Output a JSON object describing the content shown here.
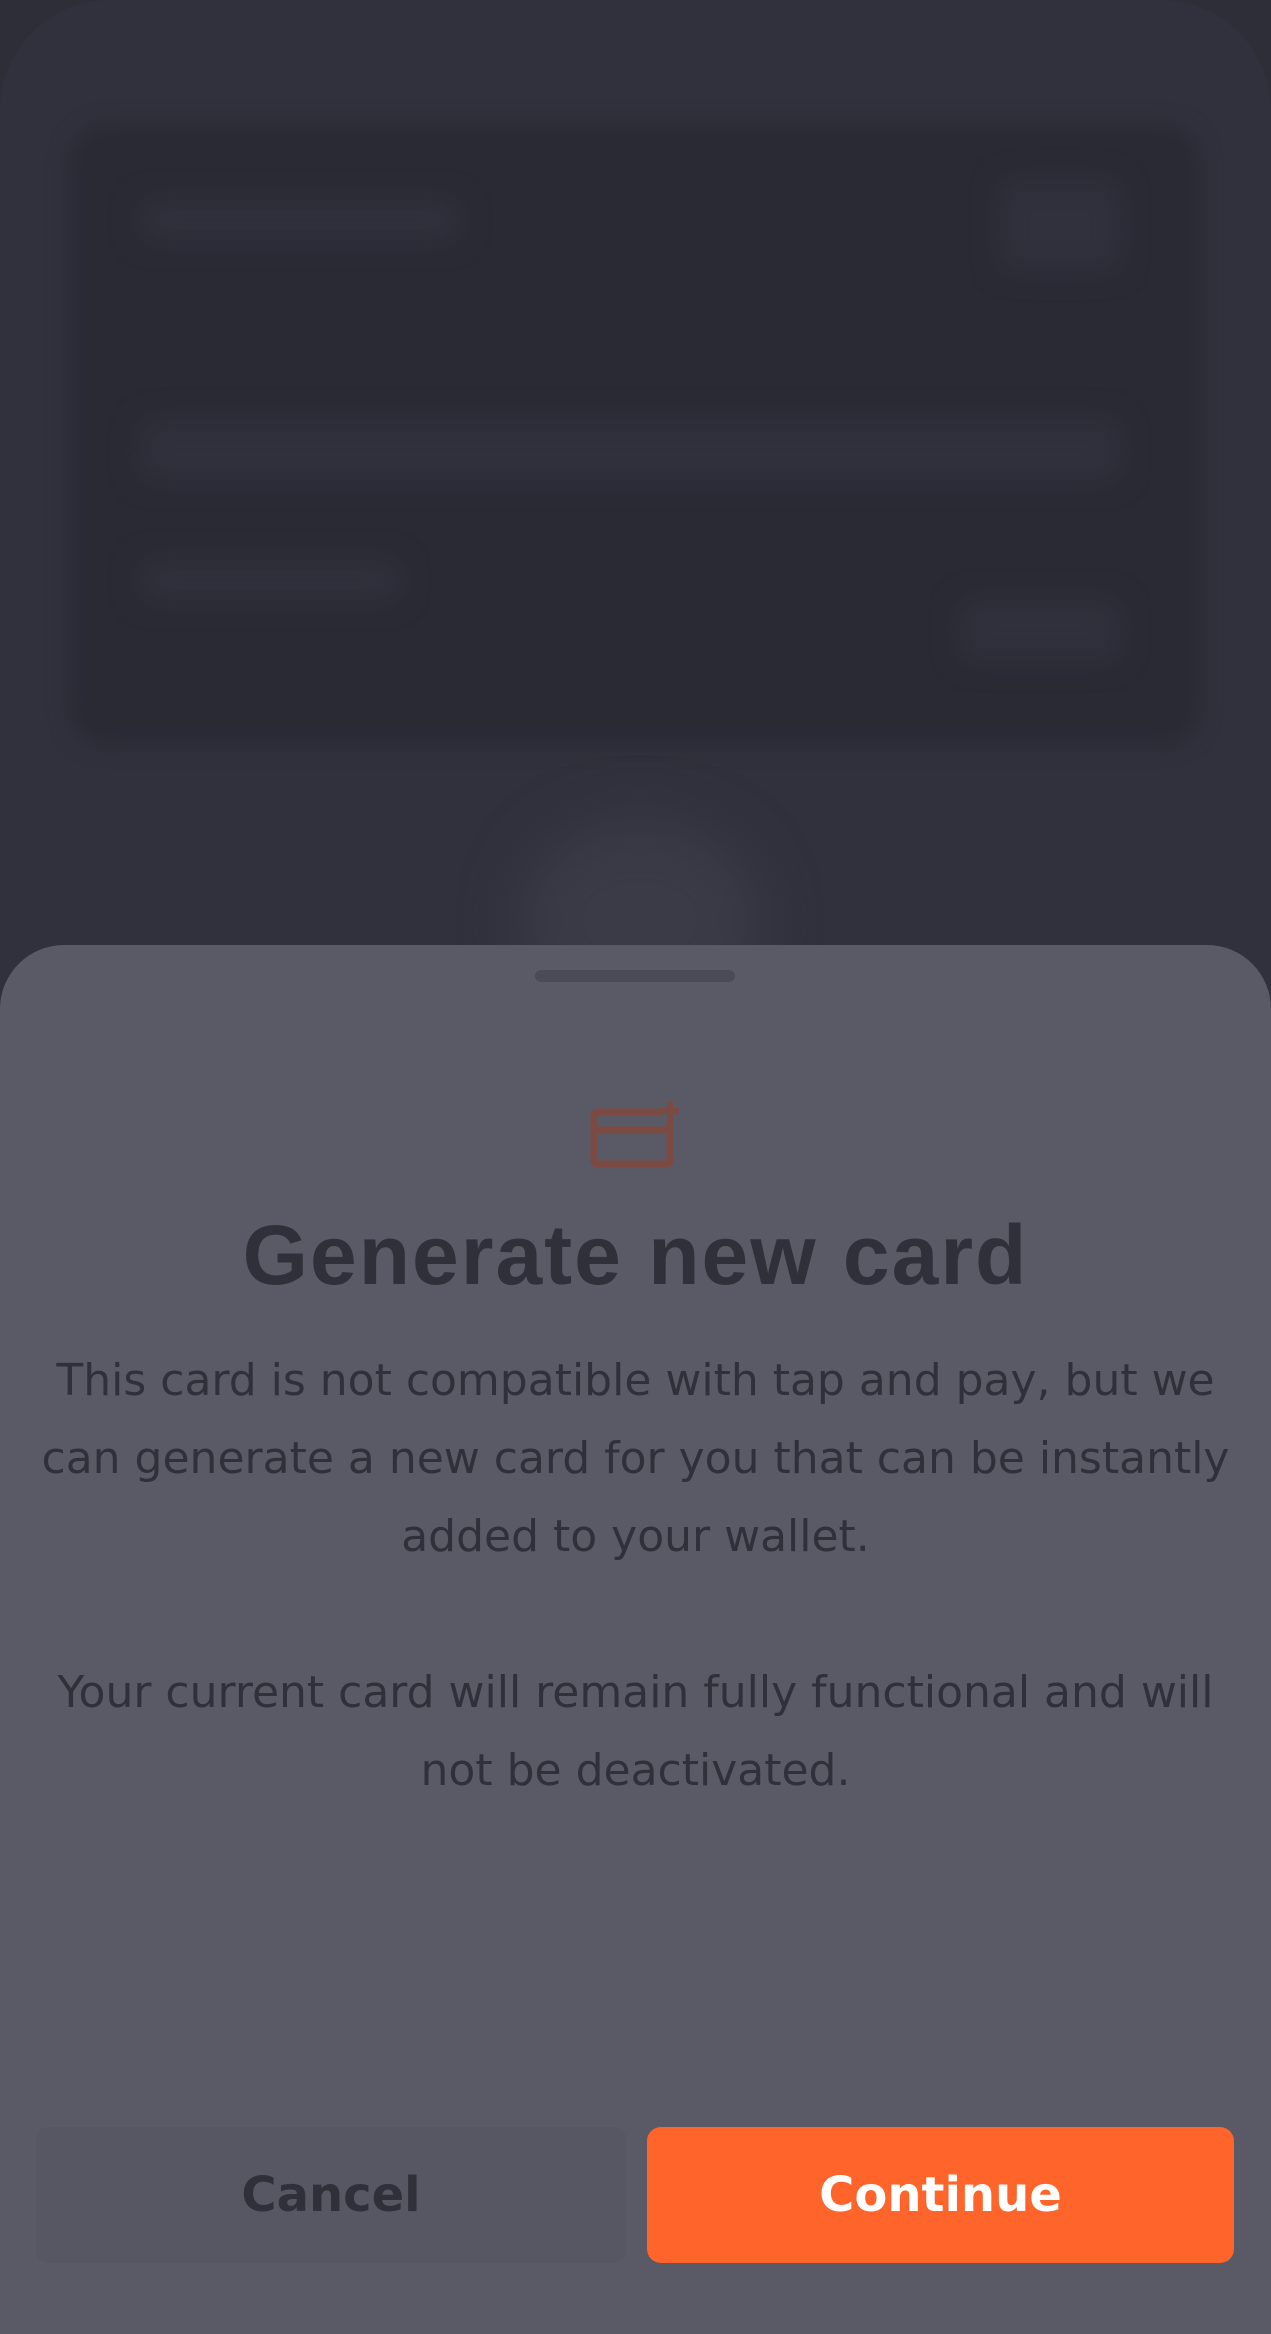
{
  "background": {
    "frame_color": "#30313c",
    "card_color": "#2a2a35"
  },
  "sheet": {
    "icon": "card-add-icon",
    "icon_color": "#7a4a43",
    "title": "Generate new card",
    "paragraphs": [
      "This card is not compatible with tap and pay, but we can generate a new card for you that can be instantly added to your wallet.",
      "Your current card will remain fully functional and will not be deactivated."
    ],
    "cancel_label": "Cancel",
    "continue_label": "Continue",
    "accent_color": "#ff652a",
    "sheet_color": "#5a5a67"
  }
}
